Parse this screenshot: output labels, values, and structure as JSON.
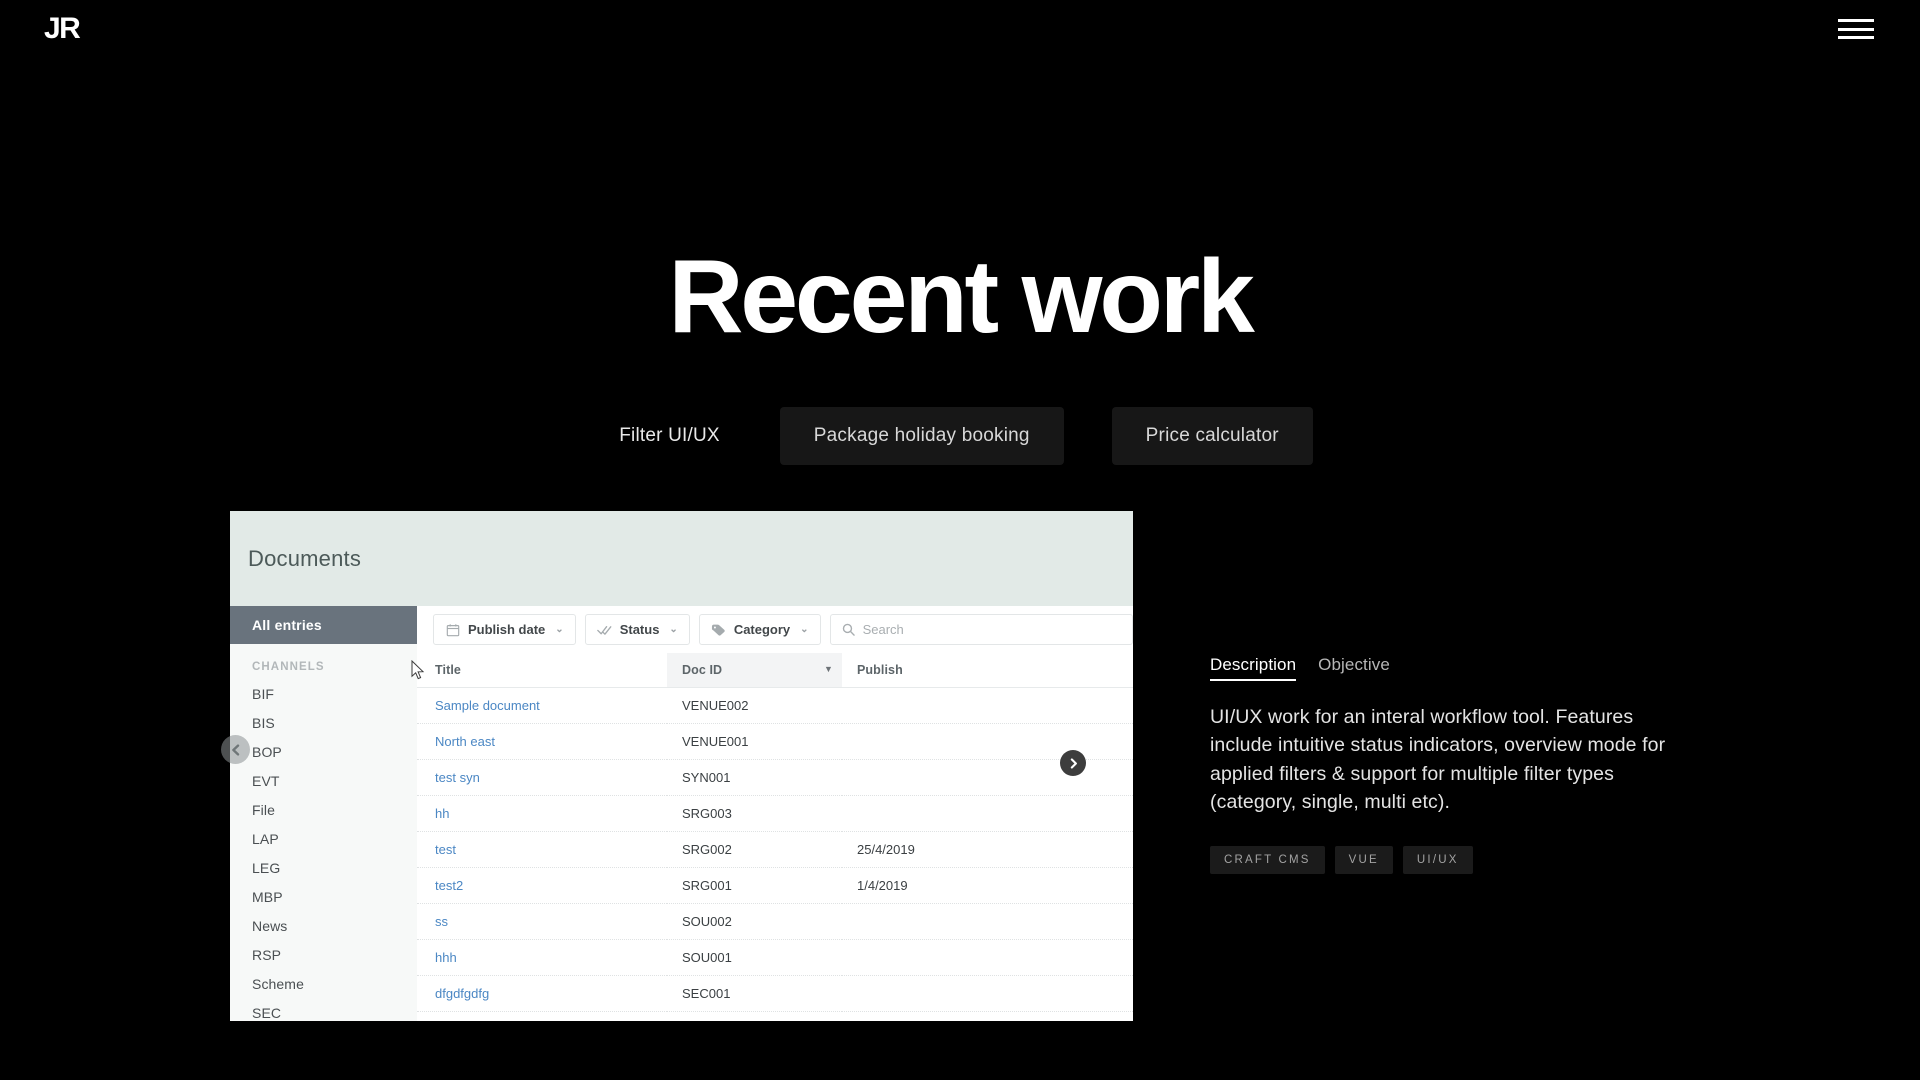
{
  "header": {
    "logo": "JR",
    "menu_icon": "hamburger-icon"
  },
  "hero": {
    "title": "Recent work"
  },
  "filters": {
    "label": "Filter UI/UX",
    "buttons": [
      {
        "label": "Package holiday booking"
      },
      {
        "label": "Price calculator"
      }
    ]
  },
  "app": {
    "title": "Documents",
    "sidebar": {
      "all_entries": "All entries",
      "section_label": "CHANNELS",
      "items": [
        {
          "label": "BIF"
        },
        {
          "label": "BIS"
        },
        {
          "label": "BOP"
        },
        {
          "label": "EVT"
        },
        {
          "label": "File"
        },
        {
          "label": "LAP"
        },
        {
          "label": "LEG"
        },
        {
          "label": "MBP"
        },
        {
          "label": "News"
        },
        {
          "label": "RSP"
        },
        {
          "label": "Scheme"
        },
        {
          "label": "SEC"
        }
      ]
    },
    "toolbar": {
      "publish_date": "Publish date",
      "status": "Status",
      "category": "Category",
      "search_placeholder": "Search",
      "search_value": "",
      "caret": "⌄"
    },
    "table": {
      "columns": {
        "title": "Title",
        "doc_id": "Doc ID",
        "publish": "Publish"
      },
      "sort_indicator": "▼",
      "rows": [
        {
          "title": "Sample document",
          "doc_id": "VENUE002",
          "publish": ""
        },
        {
          "title": "North east",
          "doc_id": "VENUE001",
          "publish": ""
        },
        {
          "title": "test syn",
          "doc_id": "SYN001",
          "publish": ""
        },
        {
          "title": "hh",
          "doc_id": "SRG003",
          "publish": ""
        },
        {
          "title": "test",
          "doc_id": "SRG002",
          "publish": "25/4/2019"
        },
        {
          "title": "test2",
          "doc_id": "SRG001",
          "publish": "1/4/2019"
        },
        {
          "title": "ss",
          "doc_id": "SOU002",
          "publish": ""
        },
        {
          "title": "hhh",
          "doc_id": "SOU001",
          "publish": ""
        },
        {
          "title": "dfgdfgdfg",
          "doc_id": "SEC001",
          "publish": ""
        }
      ]
    }
  },
  "info": {
    "tabs": [
      {
        "label": "Description",
        "active": true
      },
      {
        "label": "Objective",
        "active": false
      }
    ],
    "description": "UI/UX work for an interal workflow tool. Features include intuitive status indicators, overview mode for applied filters & support for multiple filter types (category, single, multi etc).",
    "tags": [
      {
        "label": "CRAFT CMS"
      },
      {
        "label": "VUE"
      },
      {
        "label": "UI/UX"
      }
    ]
  },
  "colors": {
    "background": "#000000",
    "panel_header": "#e2eae7",
    "sidebar_active": "#69737d",
    "link": "#4b87c4",
    "chip": "#171717"
  }
}
